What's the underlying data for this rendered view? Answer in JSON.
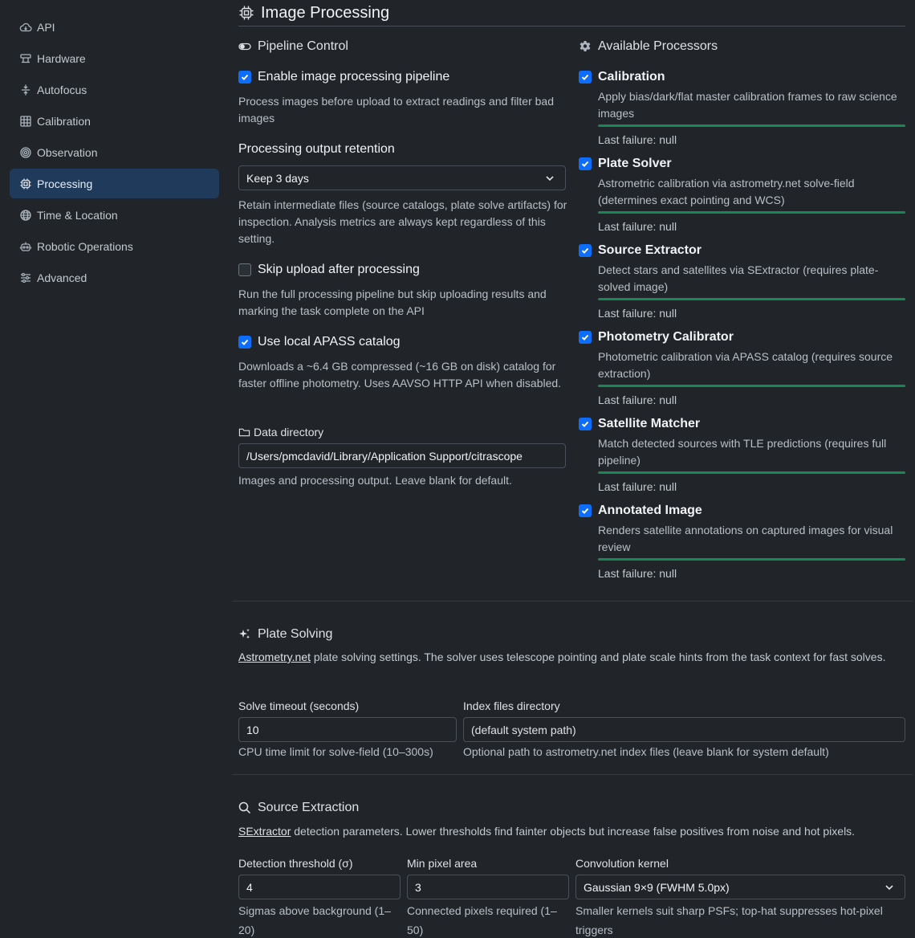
{
  "sidebar": {
    "items": [
      {
        "label": "API",
        "icon": "cloud-icon"
      },
      {
        "label": "Hardware",
        "icon": "hardware-icon"
      },
      {
        "label": "Autofocus",
        "icon": "autofocus-icon"
      },
      {
        "label": "Calibration",
        "icon": "grid-icon"
      },
      {
        "label": "Observation",
        "icon": "target-icon"
      },
      {
        "label": "Processing",
        "icon": "cpu-icon",
        "active": true
      },
      {
        "label": "Time & Location",
        "icon": "globe-icon"
      },
      {
        "label": "Robotic Operations",
        "icon": "robot-icon"
      },
      {
        "label": "Advanced",
        "icon": "sliders-icon"
      }
    ]
  },
  "page": {
    "title": "Image Processing"
  },
  "pipeline": {
    "title": "Pipeline Control",
    "enable_label": "Enable image processing pipeline",
    "enable_checked": true,
    "enable_help": "Process images before upload to extract readings and filter bad images",
    "retention_label": "Processing output retention",
    "retention_value": "Keep 3 days",
    "retention_help": "Retain intermediate files (source catalogs, plate solve artifacts) for inspection. Analysis metrics are always kept regardless of this setting.",
    "skip_label": "Skip upload after processing",
    "skip_checked": false,
    "skip_help": "Run the full processing pipeline but skip uploading results and marking the task complete on the API",
    "apass_label": "Use local APASS catalog",
    "apass_checked": true,
    "apass_help": "Downloads a ~6.4 GB compressed (~16 GB on disk) catalog for faster offline photometry. Uses AAVSO HTTP API when disabled.",
    "datadir_label": "Data directory",
    "datadir_value": "/Users/pmcdavid/Library/Application Support/citrascope",
    "datadir_help": "Images and processing output. Leave blank for default."
  },
  "processors": {
    "title": "Available Processors",
    "items": [
      {
        "name": "Calibration",
        "desc": "Apply bias/dark/flat master calibration frames to raw science images",
        "last_failure": "Last failure: null",
        "checked": true
      },
      {
        "name": "Plate Solver",
        "desc": "Astrometric calibration via astrometry.net solve-field (determines exact pointing and WCS)",
        "last_failure": "Last failure: null",
        "checked": true
      },
      {
        "name": "Source Extractor",
        "desc": "Detect stars and satellites via SExtractor (requires plate-solved image)",
        "last_failure": "Last failure: null",
        "checked": true
      },
      {
        "name": "Photometry Calibrator",
        "desc": "Photometric calibration via APASS catalog (requires source extraction)",
        "last_failure": "Last failure: null",
        "checked": true
      },
      {
        "name": "Satellite Matcher",
        "desc": "Match detected sources with TLE predictions (requires full pipeline)",
        "last_failure": "Last failure: null",
        "checked": true
      },
      {
        "name": "Annotated Image",
        "desc": "Renders satellite annotations on captured images for visual review",
        "last_failure": "Last failure: null",
        "checked": true
      }
    ]
  },
  "plate_solving": {
    "title": "Plate Solving",
    "desc_link": "Astrometry.net",
    "desc_rest": " plate solving settings. The solver uses telescope pointing and plate scale hints from the task context for fast solves.",
    "timeout_label": "Solve timeout (seconds)",
    "timeout_value": "10",
    "timeout_help": "CPU time limit for solve-field (10–300s)",
    "index_label": "Index files directory",
    "index_placeholder": "(default system path)",
    "index_help": "Optional path to astrometry.net index files (leave blank for system default)"
  },
  "source_extraction": {
    "title": "Source Extraction",
    "desc_link": "SExtractor",
    "desc_rest": " detection parameters. Lower thresholds find fainter objects but increase false positives from noise and hot pixels.",
    "threshold_label": "Detection threshold (σ)",
    "threshold_value": "4",
    "threshold_help": "Sigmas above background (1–20)",
    "minarea_label": "Min pixel area",
    "minarea_value": "3",
    "minarea_help": "Connected pixels required (1–50)",
    "kernel_label": "Convolution kernel",
    "kernel_value": "Gaussian 9×9 (FWHM 5.0px)",
    "kernel_help": "Smaller kernels suit sharp PSFs; top-hat suppresses hot-pixel triggers"
  },
  "colors": {
    "accent": "#0d6efd",
    "success": "#198754",
    "bg": "#212529",
    "active_nav": "#1f3a5b"
  }
}
